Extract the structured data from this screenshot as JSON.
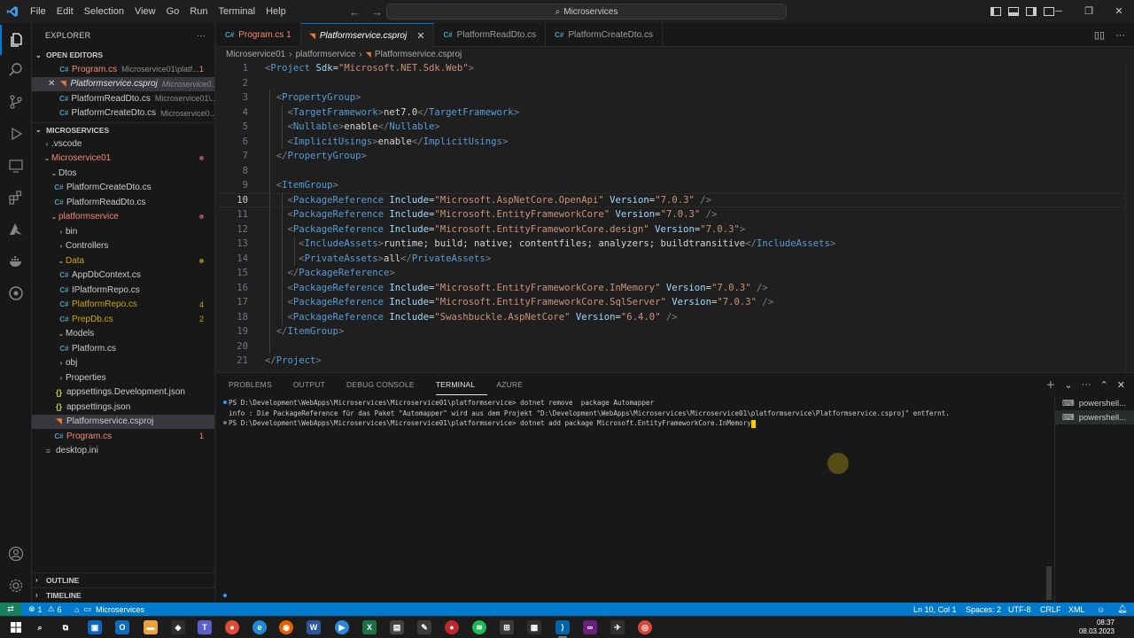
{
  "titlebar": {
    "menu": [
      "File",
      "Edit",
      "Selection",
      "View",
      "Go",
      "Run",
      "Terminal",
      "Help"
    ],
    "search_text": "Microservices"
  },
  "explorer": {
    "title": "EXPLORER",
    "open_editors_title": "OPEN EDITORS",
    "open_editors": [
      {
        "name": "Program.cs",
        "desc": "Microservice01\\platf...",
        "badge": "1",
        "icon": "C#"
      },
      {
        "name": "Platformservice.csproj",
        "desc": "Microservice0...",
        "badge": "",
        "icon": "rss"
      },
      {
        "name": "PlatformReadDto.cs",
        "desc": "Microservice01\\...",
        "badge": "",
        "icon": "C#"
      },
      {
        "name": "PlatformCreateDto.cs",
        "desc": "Microservice0...",
        "badge": "",
        "icon": "C#"
      }
    ],
    "workspace_title": "MICROSERVICES",
    "tree": [
      {
        "name": ".vscode"
      },
      {
        "name": "Microservice01"
      },
      {
        "name": "Dtos"
      },
      {
        "name": "PlatformCreateDto.cs"
      },
      {
        "name": "PlatformReadDto.cs"
      },
      {
        "name": "platformservice"
      },
      {
        "name": "bin"
      },
      {
        "name": "Controllers"
      },
      {
        "name": "Data"
      },
      {
        "name": "AppDbContext.cs"
      },
      {
        "name": "IPlatformRepo.cs"
      },
      {
        "name": "PlatformRepo.cs",
        "badge": "4"
      },
      {
        "name": "PrepDb.cs",
        "badge": "2"
      },
      {
        "name": "Models"
      },
      {
        "name": "Platform.cs"
      },
      {
        "name": "obj"
      },
      {
        "name": "Properties"
      },
      {
        "name": "appsettings.Development.json"
      },
      {
        "name": "appsettings.json"
      },
      {
        "name": "Platformservice.csproj"
      },
      {
        "name": "Program.cs",
        "badge": "1"
      },
      {
        "name": "desktop.ini"
      }
    ],
    "outline_title": "OUTLINE",
    "timeline_title": "TIMELINE"
  },
  "tabs": [
    {
      "label": "Program.cs 1"
    },
    {
      "label": "Platformservice.csproj"
    },
    {
      "label": "PlatformReadDto.cs"
    },
    {
      "label": "PlatformCreateDto.cs"
    }
  ],
  "breadcrumb": [
    "Microservice01",
    "platformservice",
    "Platformservice.csproj"
  ],
  "code_lines": [
    "1",
    "2",
    "3",
    "4",
    "5",
    "6",
    "7",
    "8",
    "9",
    "10",
    "11",
    "12",
    "13",
    "14",
    "15",
    "16",
    "17",
    "18",
    "19",
    "20",
    "21"
  ],
  "code": {
    "l1_tag": "Project",
    "l1_attr": "Sdk",
    "l1_val": "\"Microsoft.NET.Sdk.Web\"",
    "l3_tag": "PropertyGroup",
    "l4_tag": "TargetFramework",
    "l4_text": "net7.0",
    "l5_tag": "Nullable",
    "l5_text": "enable",
    "l6_tag": "ImplicitUsings",
    "l6_text": "enable",
    "l9_tag": "ItemGroup",
    "pkgref": "PackageReference",
    "include": "Include",
    "version": "Version",
    "l10_inc": "\"Microsoft.AspNetCore.OpenApi\"",
    "l10_ver": "\"7.0.3\"",
    "l11_inc": "\"Microsoft.EntityFrameworkCore\"",
    "l11_ver": "\"7.0.3\"",
    "l12_inc": "\"Microsoft.EntityFrameworkCore.design\"",
    "l12_ver": "\"7.0.3\"",
    "l13_tag": "IncludeAssets",
    "l13_text": "runtime; build; native; contentfiles; analyzers; buildtransitive",
    "l14_tag": "PrivateAssets",
    "l14_text": "all",
    "l17_inc": "\"Microsoft.EntityFrameworkCore.InMemory\"",
    "l17_ver": "\"7.0.3\"",
    "l18_inc": "\"Microsoft.EntityFrameworkCore.SqlServer\"",
    "l18_ver": "\"7.0.3\"",
    "l19_inc": "\"Swashbuckle.AspNetCore\"",
    "l19_ver": "\"6.4.0\""
  },
  "panel": {
    "tabs": [
      "PROBLEMS",
      "OUTPUT",
      "DEBUG CONSOLE",
      "TERMINAL",
      "AZURE"
    ],
    "terminal_lines": [
      "PS D:\\Development\\WebApps\\Microservices\\Microservice01\\platformservice> dotnet remove  package Automapper",
      "info : Die PackageReference für das Paket \"Automapper\" wird aus dem Projekt \"D:\\Development\\WebApps\\Microservices\\Microservice01\\platformservice\\Platformservice.csproj\" entfernt.",
      "PS D:\\Development\\WebApps\\Microservices\\Microservice01\\platformservice> dotnet add package Microsoft.EntityFrameworkCore.InMemory"
    ],
    "terminal_instances": [
      "powershell...",
      "powershell..."
    ]
  },
  "statusbar": {
    "errors": "1",
    "warnings": "6",
    "folder": "Microservices",
    "position": "Ln 10, Col 1",
    "spaces": "Spaces: 2",
    "encoding": "UTF-8",
    "eol": "CRLF",
    "language": "XML"
  },
  "taskbar": {
    "time": "08:37",
    "date": "08.03.2023"
  },
  "colors": {
    "accent": "#007acc",
    "remote": "#16825d",
    "error": "#f48771",
    "warning": "#cca700"
  }
}
